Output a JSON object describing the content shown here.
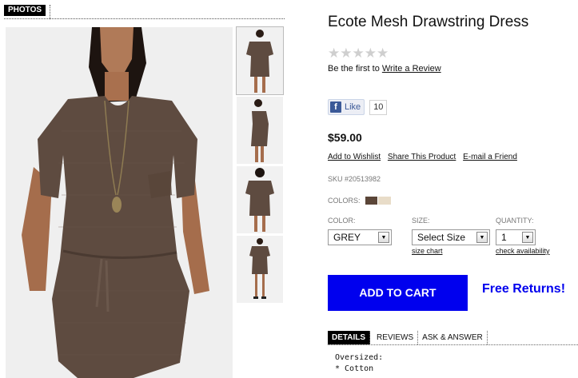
{
  "photos": {
    "tab_label": "PHOTOS",
    "main_image_label": "Model wearing grey-brown mesh drawstring dress",
    "thumbnails": [
      "front view",
      "side view",
      "back view",
      "full length view"
    ]
  },
  "product": {
    "title": "Ecote Mesh Drawstring Dress",
    "rating_stars": "★★★★★",
    "review_prefix": "Be the first to ",
    "review_link": "Write a Review",
    "like_label": "Like",
    "like_count": "10",
    "price": "$59.00",
    "links": {
      "wishlist": "Add to Wishlist",
      "share": "Share This Product",
      "email": "E-mail a Friend"
    },
    "sku": "SKU #20513982",
    "colors_label": "COLORS:",
    "color_swatches": [
      "#5b4638",
      "#e8dcc8"
    ]
  },
  "options": {
    "color_label": "COLOR:",
    "color_value": "GREY",
    "size_label": "SIZE:",
    "size_value": "Select Size",
    "size_chart": "size chart",
    "quantity_label": "QUANTITY:",
    "quantity_value": "1",
    "check_availability": "check availability"
  },
  "actions": {
    "add_to_cart": "ADD TO CART",
    "free_returns": "Free Returns!"
  },
  "tabs": [
    "DETAILS",
    "REVIEWS",
    "ASK & ANSWER"
  ],
  "details": {
    "line1": "Oversized:",
    "line2": "* Cotton"
  },
  "colors": {
    "cart_blue": "#0000ee",
    "dress": "#5e4b40"
  }
}
